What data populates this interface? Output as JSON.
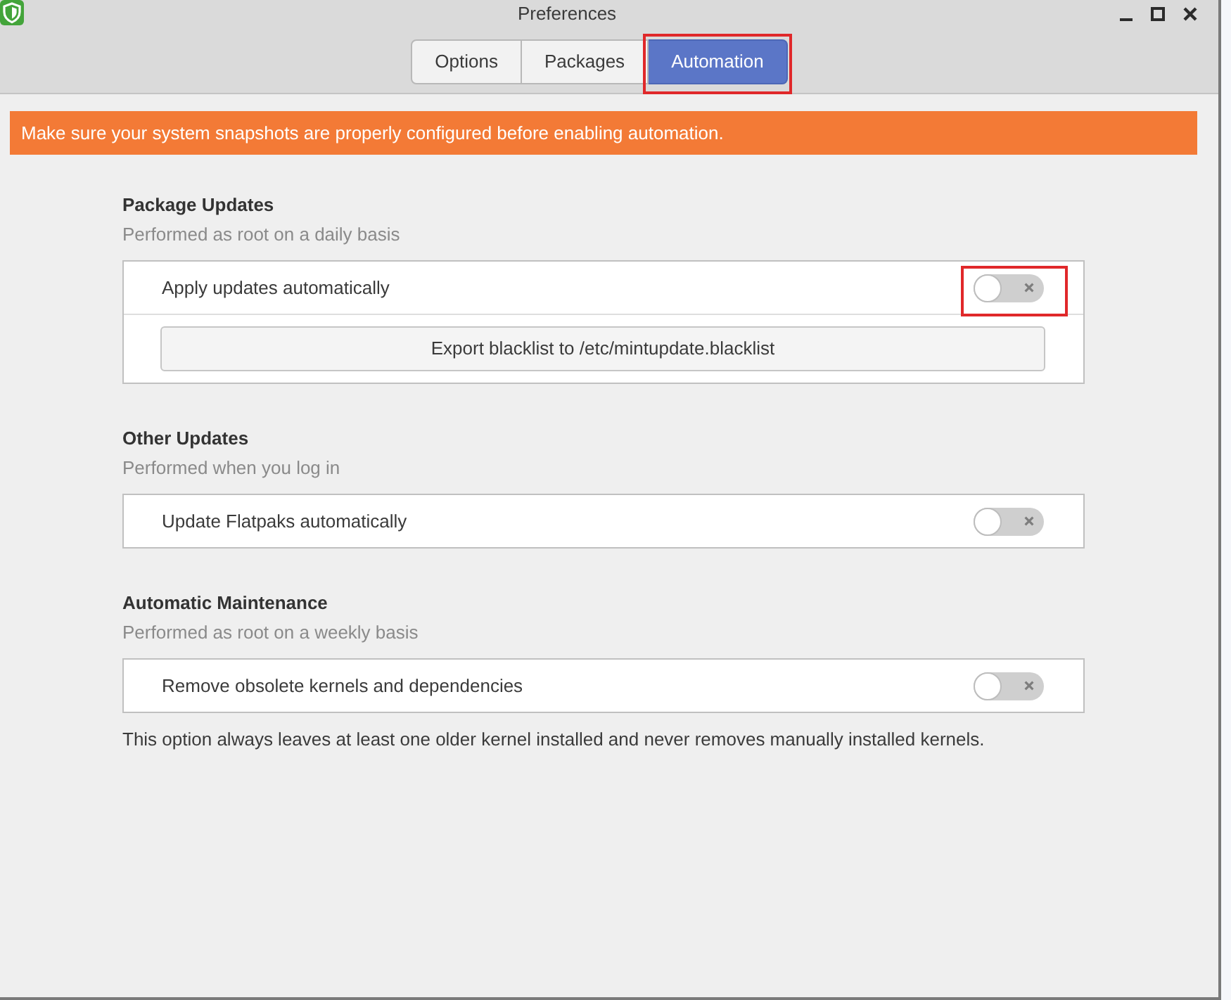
{
  "window": {
    "title": "Preferences"
  },
  "tabs": [
    {
      "label": "Options",
      "selected": false,
      "highlighted": false
    },
    {
      "label": "Packages",
      "selected": false,
      "highlighted": false
    },
    {
      "label": "Automation",
      "selected": true,
      "highlighted": true
    }
  ],
  "banner": {
    "text": "Make sure your system snapshots are properly configured before enabling automation."
  },
  "sections": [
    {
      "title": "Package Updates",
      "subtitle": "Performed as root on a daily basis",
      "rows": [
        {
          "kind": "switch",
          "label": "Apply updates automatically",
          "on": false,
          "highlighted": true
        },
        {
          "kind": "button",
          "label": "Export blacklist to /etc/mintupdate.blacklist",
          "highlighted": false
        }
      ]
    },
    {
      "title": "Other Updates",
      "subtitle": "Performed when you log in",
      "rows": [
        {
          "kind": "switch",
          "label": "Update Flatpaks automatically",
          "on": false,
          "highlighted": false
        }
      ]
    },
    {
      "title": "Automatic Maintenance",
      "subtitle": "Performed as root on a weekly basis",
      "rows": [
        {
          "kind": "switch",
          "label": "Remove obsolete kernels and dependencies",
          "on": false,
          "highlighted": false
        }
      ],
      "note": "This option always leaves at least one older kernel installed and never removes manually installed kernels."
    }
  ]
}
